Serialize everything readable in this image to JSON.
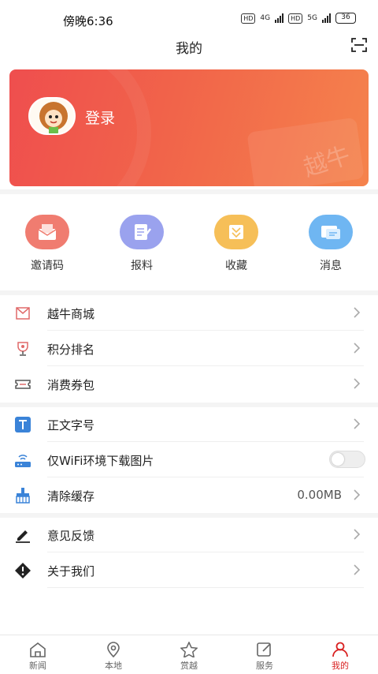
{
  "status_bar": {
    "time": "傍晚6:36",
    "hd1": "HD",
    "net1": "4G",
    "hd2": "HD",
    "net2": "5G",
    "battery": "36"
  },
  "header": {
    "title": "我的"
  },
  "banner": {
    "login_label": "登录",
    "watermark": "越牛"
  },
  "quick_actions": [
    {
      "label": "邀请码",
      "icon": "envelope-icon",
      "color": "#f07c70"
    },
    {
      "label": "报料",
      "icon": "document-edit-icon",
      "color": "#9aa2ee"
    },
    {
      "label": "收藏",
      "icon": "bookmark-icon",
      "color": "#f6bf58"
    },
    {
      "label": "消息",
      "icon": "message-icon",
      "color": "#6fb6f2"
    }
  ],
  "menu_group_1": [
    {
      "label": "越牛商城",
      "icon": "shopping-bag-icon"
    },
    {
      "label": "积分排名",
      "icon": "trophy-icon"
    },
    {
      "label": "消费券包",
      "icon": "ticket-icon"
    }
  ],
  "menu_group_2": [
    {
      "label": "正文字号",
      "icon": "text-size-icon"
    },
    {
      "label": "仅WiFi环境下载图片",
      "icon": "router-icon",
      "toggle_on": false
    },
    {
      "label": "清除缓存",
      "icon": "broom-icon",
      "value": "0.00MB"
    }
  ],
  "menu_group_3": [
    {
      "label": "意见反馈",
      "icon": "pencil-icon"
    },
    {
      "label": "关于我们",
      "icon": "info-icon"
    }
  ],
  "tabbar": [
    {
      "label": "新闻",
      "icon": "home-icon",
      "active": false
    },
    {
      "label": "本地",
      "icon": "location-pin-icon",
      "active": false
    },
    {
      "label": "赏越",
      "icon": "star-icon",
      "active": false
    },
    {
      "label": "服务",
      "icon": "edit-square-icon",
      "active": false
    },
    {
      "label": "我的",
      "icon": "user-icon",
      "active": true
    }
  ],
  "colors": {
    "accent": "#d92222",
    "banner_start": "#ef4e4e",
    "banner_end": "#f5834c"
  }
}
